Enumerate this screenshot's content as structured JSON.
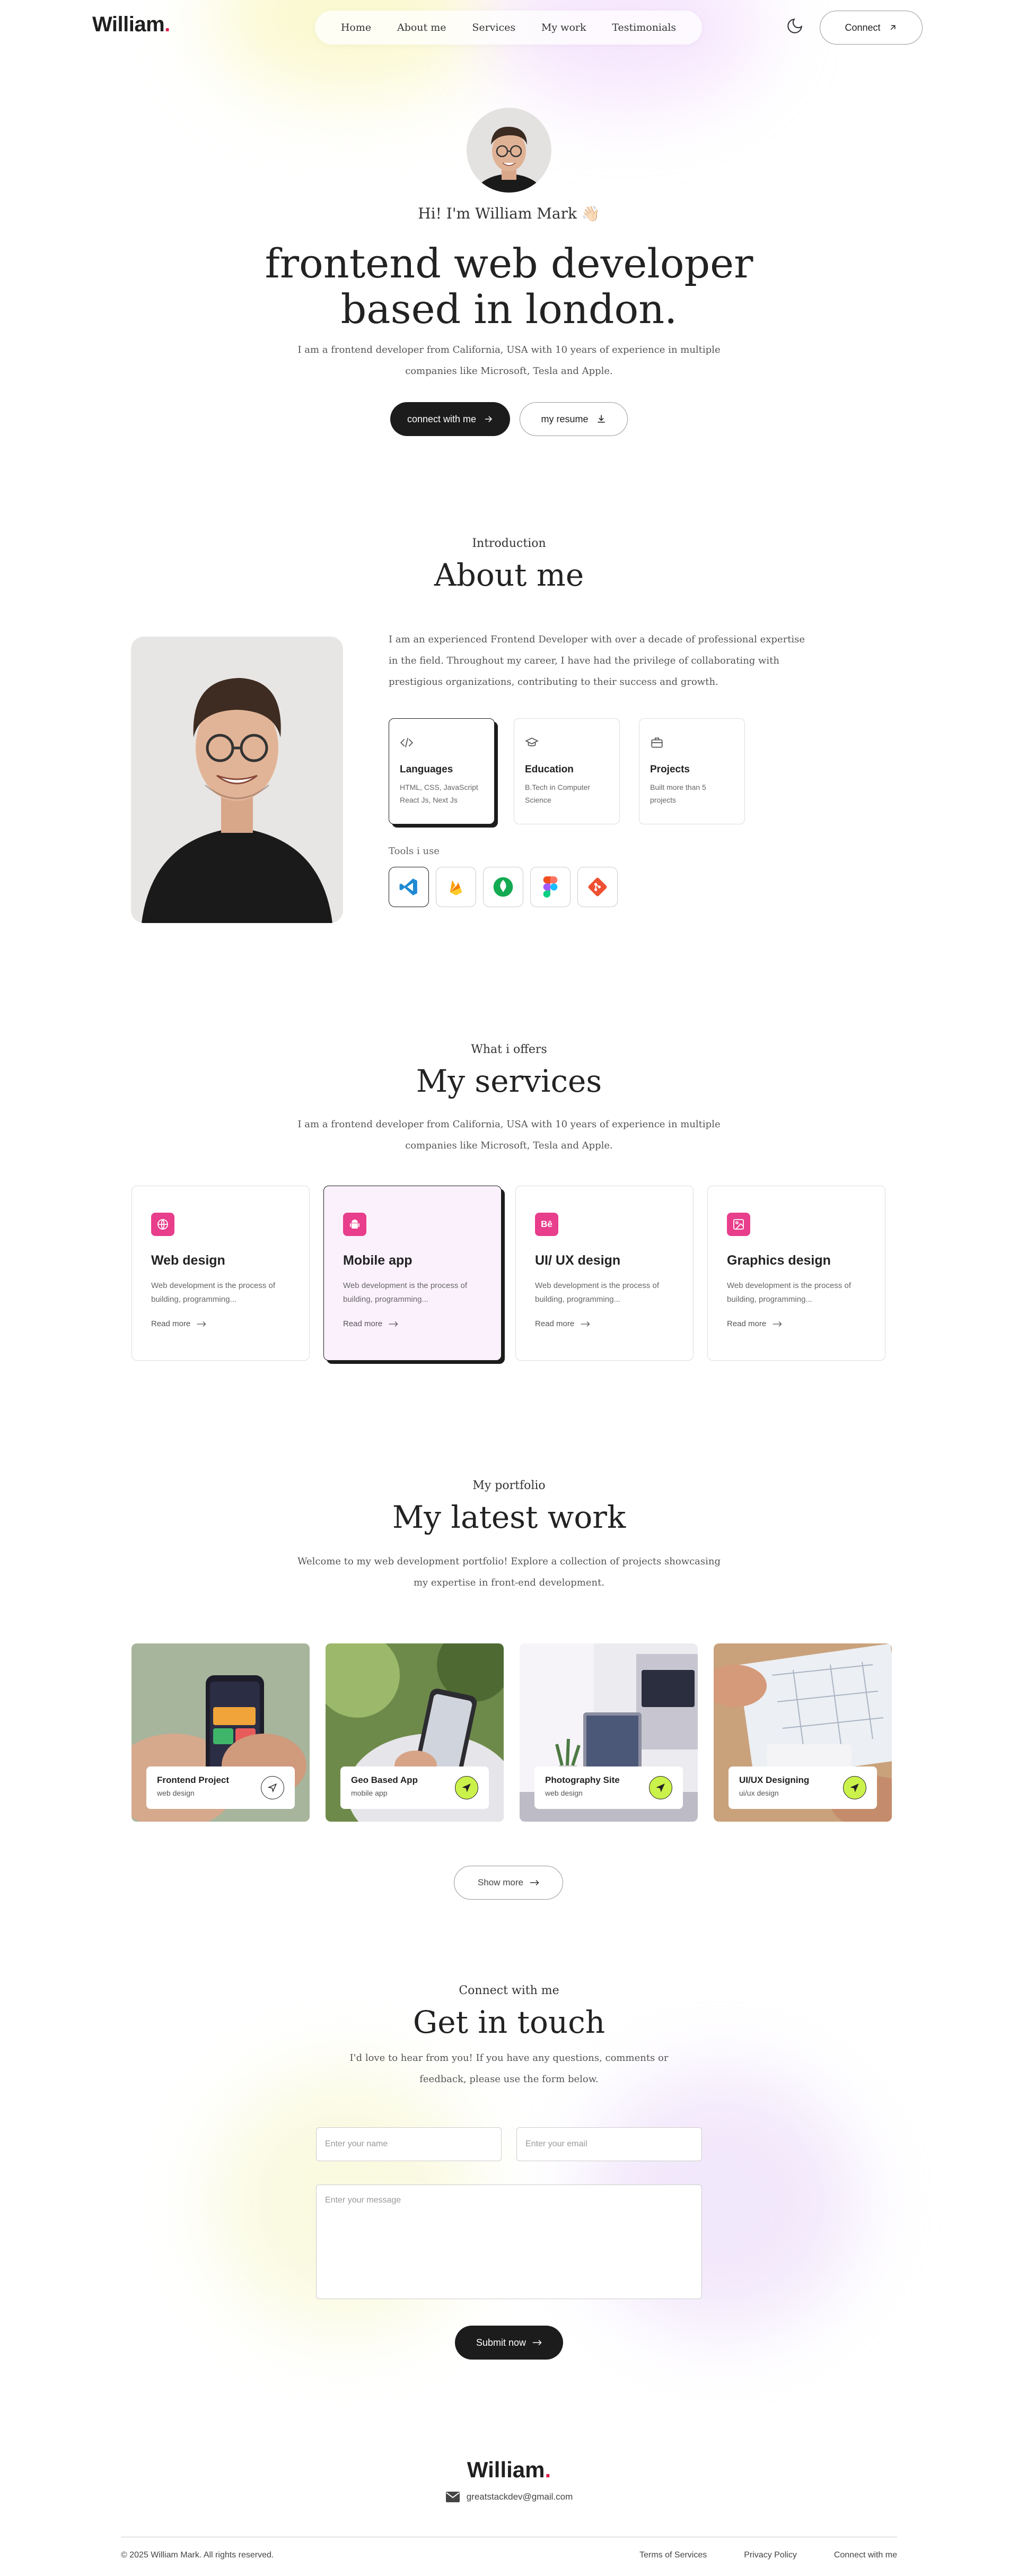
{
  "nav": {
    "logo_text": "William",
    "logo_dot": ".",
    "links": [
      "Home",
      "About me",
      "Services",
      "My work",
      "Testimonials"
    ],
    "connect_label": "Connect"
  },
  "hero": {
    "greeting": "Hi! I'm William Mark 👋🏻",
    "title": "frontend web developer based in london.",
    "description": "I am a frontend developer from California, USA with 10 years of experience in multiple companies like Microsoft, Tesla and Apple.",
    "primary_button": "connect with me",
    "secondary_button": "my resume"
  },
  "about": {
    "subtitle": "Introduction",
    "title": "About me",
    "text": "I am an experienced Frontend Developer with over a decade of professional expertise in the field. Throughout my career, I have had the privilege of collaborating with prestigious organizations, contributing to their success and growth.",
    "cards": [
      {
        "title": "Languages",
        "desc": "HTML, CSS, JavaScript React Js, Next Js",
        "icon": "code-icon"
      },
      {
        "title": "Education",
        "desc": "B.Tech in Computer Science",
        "icon": "graduation-cap-icon"
      },
      {
        "title": "Projects",
        "desc": "Built more than 5 projects",
        "icon": "briefcase-icon"
      }
    ],
    "tools_label": "Tools i use",
    "tools": [
      "vscode-icon",
      "firebase-icon",
      "mongodb-icon",
      "figma-icon",
      "git-icon"
    ]
  },
  "services": {
    "subtitle": "What i offers",
    "title": "My services",
    "description": "I am a frontend developer from California, USA with 10 years of experience in multiple companies like Microsoft, Tesla and Apple.",
    "items": [
      {
        "title": "Web design",
        "desc": "Web development is the process of building, programming...",
        "more": "Read more",
        "icon": "globe-icon"
      },
      {
        "title": "Mobile app",
        "desc": "Web development is the process of building, programming...",
        "more": "Read more",
        "icon": "android-icon"
      },
      {
        "title": "UI/ UX design",
        "desc": "Web development is the process of building, programming...",
        "more": "Read more",
        "icon": "behance-icon"
      },
      {
        "title": "Graphics design",
        "desc": "Web development is the process of building, programming...",
        "more": "Read more",
        "icon": "image-icon"
      }
    ],
    "accent_color": "#e83e8c"
  },
  "portfolio": {
    "subtitle": "My portfolio",
    "title": "My latest work",
    "description": "Welcome to my web development portfolio! Explore a collection of projects showcasing my expertise in front-end development.",
    "items": [
      {
        "title": "Frontend Project",
        "sub": "web design"
      },
      {
        "title": "Geo Based App",
        "sub": "mobile app"
      },
      {
        "title": "Photography Site",
        "sub": "web design"
      },
      {
        "title": "UI/UX Designing",
        "sub": "ui/ux design"
      }
    ],
    "show_more": "Show more"
  },
  "contact": {
    "subtitle": "Connect with me",
    "title": "Get in touch",
    "description": "I'd love to hear from you! If you have any questions, comments or feedback, please use the form below.",
    "name_placeholder": "Enter your name",
    "email_placeholder": "Enter your email",
    "message_placeholder": "Enter your message",
    "submit_label": "Submit now"
  },
  "footer": {
    "logo_text": "William",
    "logo_dot": ".",
    "email": "greatstackdev@gmail.com",
    "copyright": "© 2025 William Mark. All rights reserved.",
    "links": [
      "Terms of Services",
      "Privacy Policy",
      "Connect with me"
    ]
  },
  "colors": {
    "dark": "#1c1c1c",
    "pink": "#e83e8c",
    "lime": "#cbf24a",
    "logo_dot": "#e11d48"
  }
}
